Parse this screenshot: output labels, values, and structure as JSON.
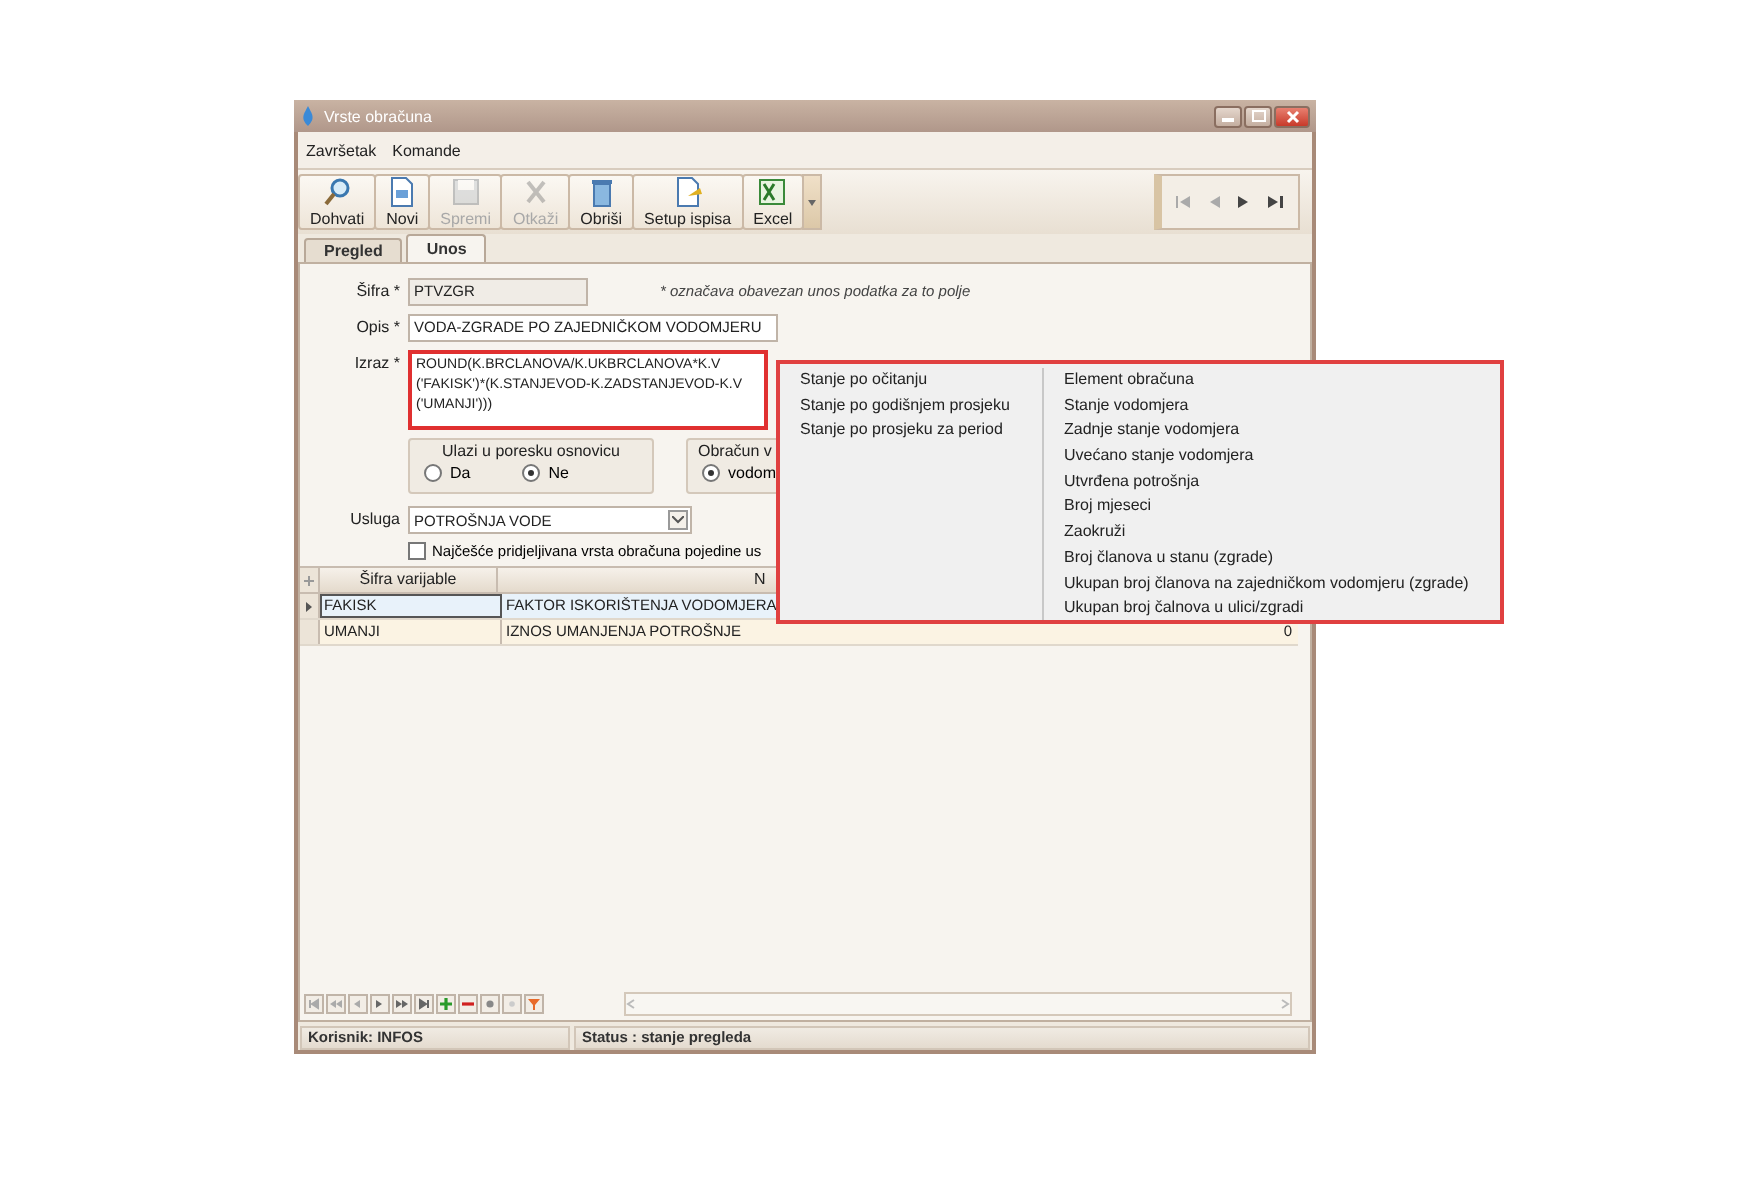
{
  "window": {
    "title": "Vrste obračuna"
  },
  "menu": [
    "Završetak",
    "Komande"
  ],
  "toolbar": [
    {
      "label": "Dohvati",
      "kind": "search",
      "disabled": false
    },
    {
      "label": "Novi",
      "kind": "document",
      "disabled": false
    },
    {
      "label": "Spremi",
      "kind": "save",
      "disabled": true
    },
    {
      "label": "Otkaži",
      "kind": "cancel",
      "disabled": true
    },
    {
      "label": "Obriši",
      "kind": "trash",
      "disabled": false
    },
    {
      "label": "Setup ispisa",
      "kind": "setup",
      "disabled": false
    },
    {
      "label": "Excel",
      "kind": "excel",
      "disabled": false
    }
  ],
  "tabs": [
    {
      "label": "Pregled",
      "selected": false
    },
    {
      "label": "Unos",
      "selected": true
    }
  ],
  "form": {
    "sifra": {
      "label": "Šifra *",
      "value": "PTVZGR"
    },
    "required_note": "* označava obavezan unos podatka za to polje",
    "opis": {
      "label": "Opis *",
      "value": "VODA-ZGRADE PO ZAJEDNIČKOM VODOMJERU"
    },
    "izraz": {
      "label": "Izraz *",
      "value": "ROUND(K.BRCLANOVA/K.UKBRCLANOVA*K.V\n('FAKISK')*(K.STANJEVOD-K.ZADSTANJEVOD-K.V\n('UMANJI')))"
    },
    "groups": [
      {
        "title": "Ulazi u poresku osnovicu",
        "options": [
          {
            "label": "Da",
            "selected": false
          },
          {
            "label": "Ne",
            "selected": true
          }
        ]
      },
      {
        "title": "Obračun v",
        "options": [
          {
            "label": "vodom",
            "selected": true
          }
        ]
      }
    ],
    "usluga": {
      "label": "Usluga",
      "value": "POTROŠNJA VODE"
    },
    "checkbox": {
      "label": "Najčešće pridjeljivana vrsta obračuna pojedine us",
      "checked": false
    }
  },
  "grid": {
    "columns": [
      "Šifra varijable",
      "N"
    ],
    "rows": [
      {
        "cells": [
          "FAKISK",
          "FAKTOR ISKORIŠTENJA VODOMJERA"
        ],
        "selected": true
      },
      {
        "cells": [
          "UMANJI",
          "IZNOS UMANJENJA POTROŠNJE",
          "0"
        ],
        "selected": false
      }
    ]
  },
  "status_bar": [
    "Korisnik: INFOS",
    "Status : stanje pregleda"
  ],
  "context_menu": {
    "left": [
      "Stanje po očitanju",
      "Stanje po godišnjem prosjeku",
      "Stanje po prosjeku za period"
    ],
    "right": [
      "Element obračuna",
      "Stanje vodomjera",
      "Zadnje stanje vodomjera",
      "Uvećano stanje vodomjera",
      "Utvrđena potrošnja",
      "Broj mjeseci",
      "Zaokruži",
      "Broj članova u stanu (zgrade)",
      "Ukupan broj članova na zajedničkom vodomjeru (zgrade)",
      "Ukupan broj čalnova u ulici/zgradi"
    ]
  }
}
